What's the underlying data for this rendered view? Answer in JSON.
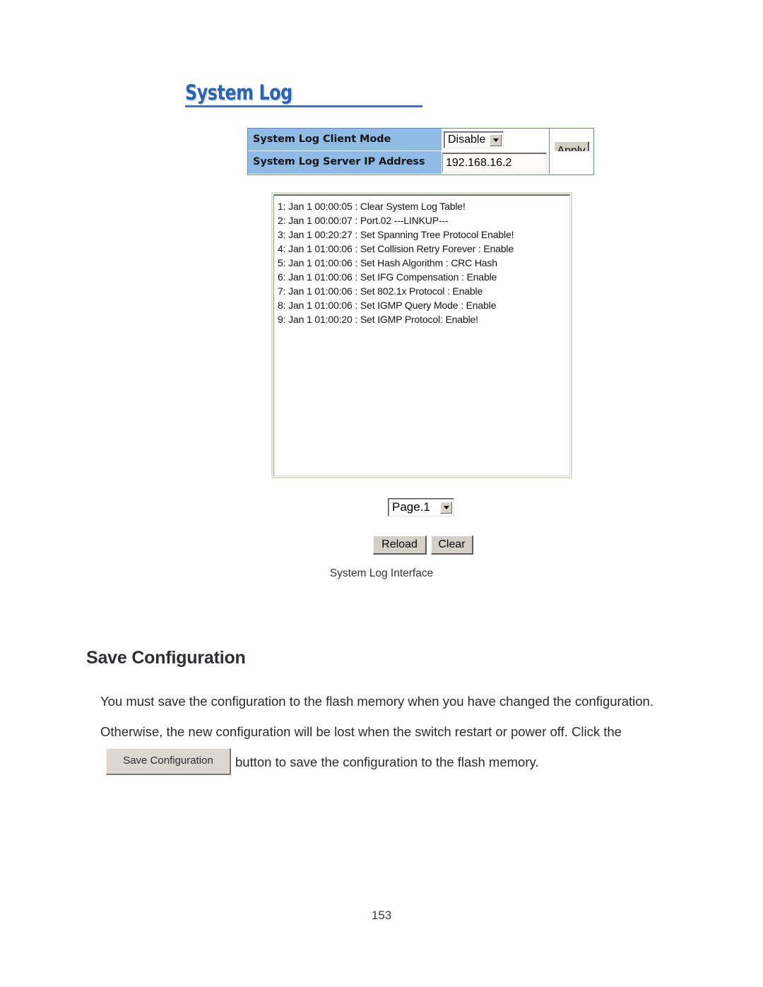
{
  "document": {
    "page_number": "153",
    "section_heading": "Save Configuration",
    "figure_caption": "System Log Interface",
    "paragraph_part1": "You must save the configuration to the flash memory when you have changed the configuration. Otherwise, the new configuration will be lost when the switch restart or power off. Click the",
    "paragraph_part2": "button to save the configuration to the flash memory."
  },
  "screenshot": {
    "title": "System Log",
    "config_table": {
      "rows": [
        {
          "label": "System Log Client Mode",
          "value": "Disable",
          "control": "select"
        },
        {
          "label": "System Log Server IP Address",
          "value": "192.168.16.2",
          "control": "text"
        }
      ],
      "apply_label": "Apply"
    },
    "log_lines": [
      "1: Jan 1 00:00:05 : Clear System Log Table!",
      "2: Jan 1 00:00:07 : Port.02 ---LINKUP---",
      "3: Jan 1 00:20:27 : Set Spanning Tree Protocol Enable!",
      "4: Jan 1 01:00:06 : Set Collision Retry Forever : Enable",
      "5: Jan 1 01:00:06 : Set Hash Algorithm : CRC Hash",
      "6: Jan 1 01:00:06 : Set IFG Compensation : Enable",
      "7: Jan 1 01:00:06 : Set 802.1x Protocol : Enable",
      "8: Jan 1 01:00:06 : Set IGMP Query Mode : Enable",
      "9: Jan 1 01:00:20 : Set IGMP Protocol: Enable!"
    ],
    "page_selector": {
      "value": "Page.1"
    },
    "buttons": {
      "reload_label": "Reload",
      "clear_label": "Clear",
      "save_configuration_label": "Save Configuration"
    }
  },
  "colors": {
    "title_blue": "#2b63b0",
    "table_header_blue": "#8fbce4",
    "table_border_blue": "#5a87bd",
    "button_face": "#d4d0c8",
    "save_button_face": "#ddd7d4",
    "log_panel_border": "#d7e0cf"
  }
}
